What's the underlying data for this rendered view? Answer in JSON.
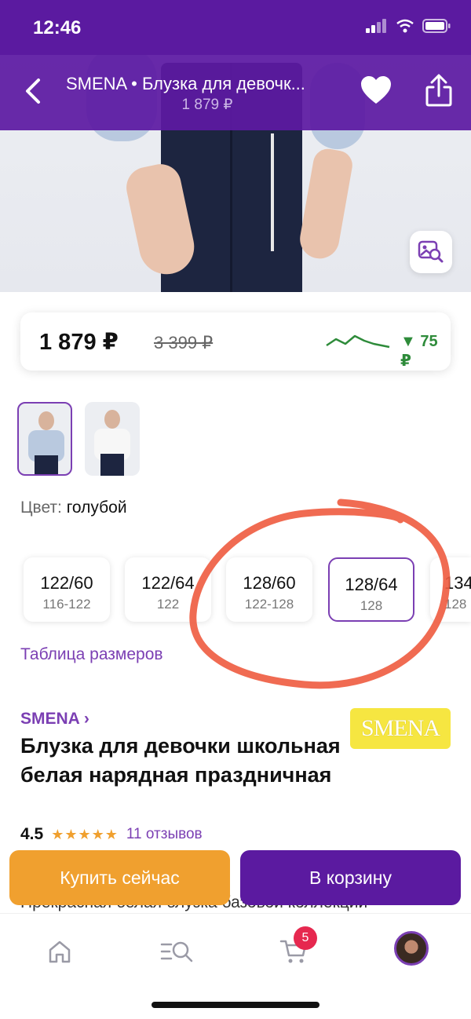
{
  "status_bar": {
    "time": "12:46"
  },
  "header": {
    "title": "SMENA • Блузка для девочк...",
    "price": "1 879 ₽"
  },
  "price_card": {
    "price": "1 879 ₽",
    "old_price": "3 399 ₽",
    "price_drop": "▼ 75 ₽",
    "trend_color": "#2e8b3a"
  },
  "color": {
    "label": "Цвет:",
    "value": "голубой"
  },
  "sizes": [
    {
      "main": "122/60",
      "sub": "116-122",
      "selected": false
    },
    {
      "main": "122/64",
      "sub": "122",
      "selected": false
    },
    {
      "main": "128/60",
      "sub": "122-128",
      "selected": false
    },
    {
      "main": "128/64",
      "sub": "128",
      "selected": true
    },
    {
      "main": "134",
      "sub": "128",
      "selected": false
    }
  ],
  "size_table_link": "Таблица размеров",
  "brand": {
    "name": "SMENA ›",
    "logo_text": "SMENA"
  },
  "product": {
    "title": "Блузка для девочки школьная белая нарядная праздничная",
    "rating": "4.5",
    "stars": "★★★★★",
    "reviews": "11 отзывов",
    "description": "Прекрасная белая блузка базовой коллекции"
  },
  "actions": {
    "buy_now": "Купить сейчас",
    "add_to_cart": "В корзину"
  },
  "tabbar": {
    "cart_badge": "5"
  },
  "colors": {
    "accent": "#5b1aa0",
    "link": "#7b3fb3",
    "buy": "#f0a02f",
    "badge": "#e6284f",
    "annotation": "#ee5b3f"
  }
}
